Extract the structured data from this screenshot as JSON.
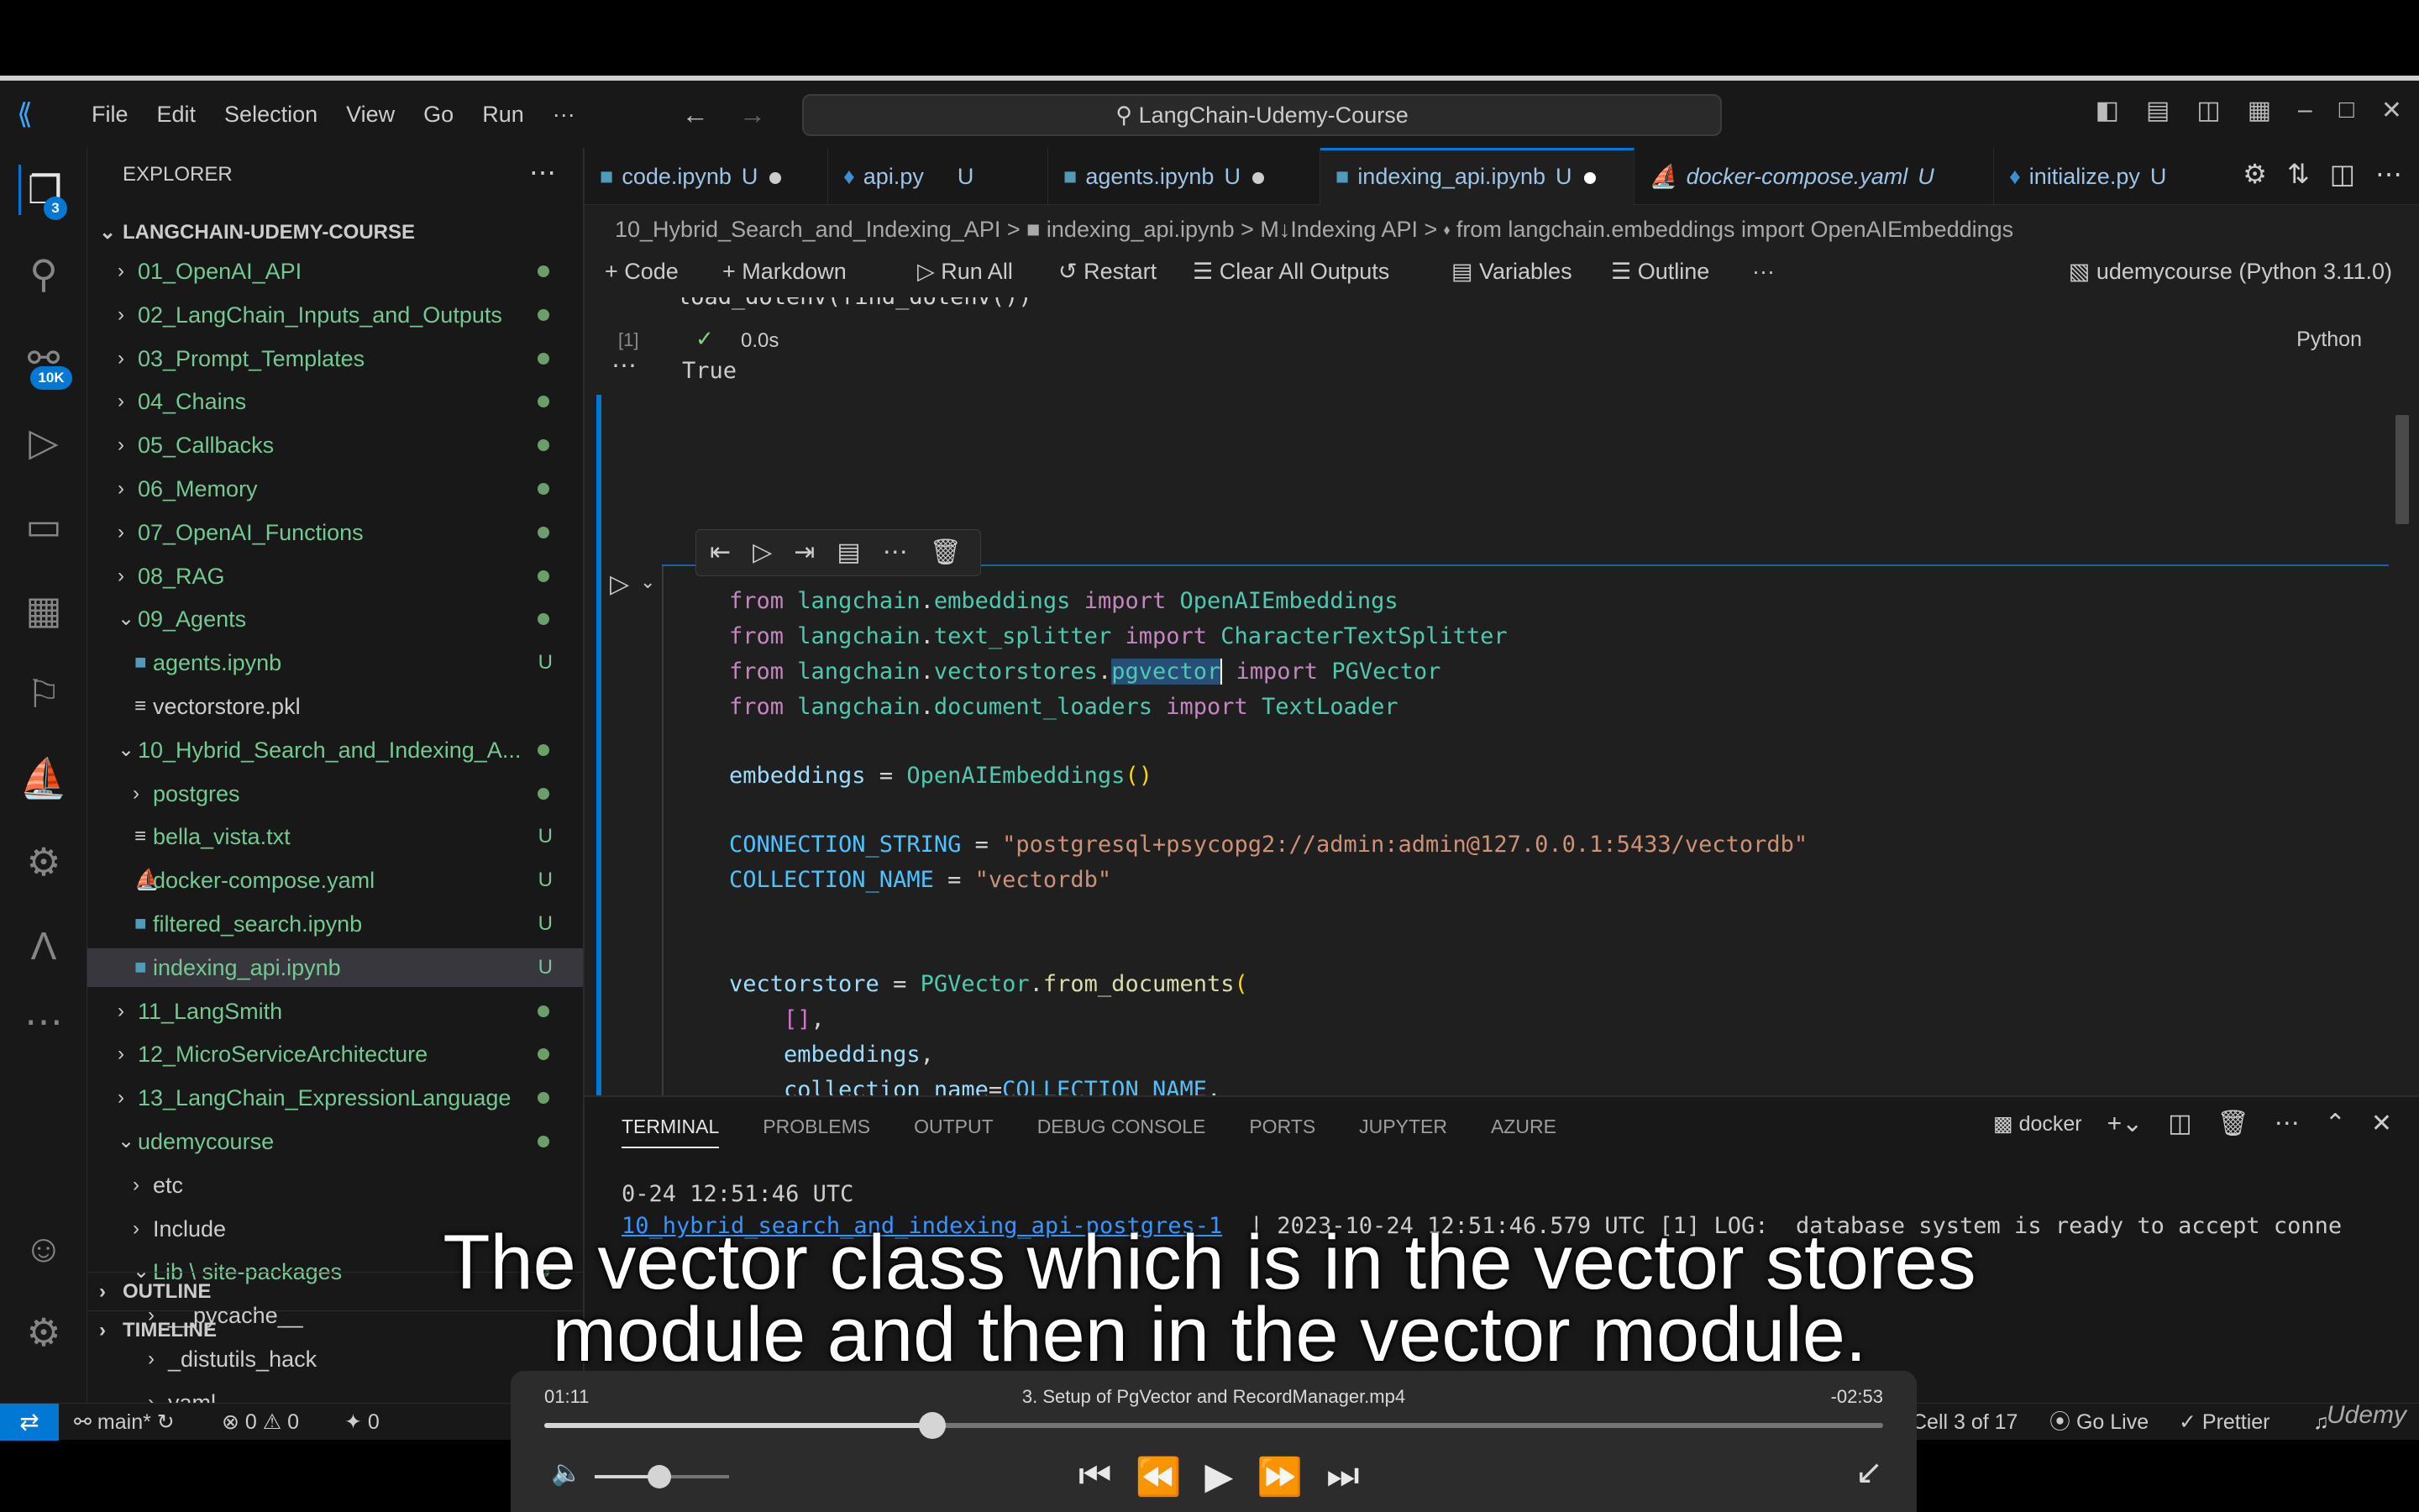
{
  "titlebar": {
    "menu": [
      "File",
      "Edit",
      "Selection",
      "View",
      "Go",
      "Run",
      "···"
    ],
    "search": "LangChain-Udemy-Course"
  },
  "activity": {
    "explorer_badge": "3",
    "source_control_badge": "10K"
  },
  "explorer": {
    "title": "EXPLORER",
    "root": "LANGCHAIN-UDEMY-COURSE",
    "items": [
      {
        "label": "01_OpenAI_API",
        "status": "dot",
        "chev": ">",
        "level": 1
      },
      {
        "label": "02_LangChain_Inputs_and_Outputs",
        "status": "dot",
        "chev": ">",
        "level": 1
      },
      {
        "label": "03_Prompt_Templates",
        "status": "dot",
        "chev": ">",
        "level": 1
      },
      {
        "label": "04_Chains",
        "status": "dot",
        "chev": ">",
        "level": 1
      },
      {
        "label": "05_Callbacks",
        "status": "dot",
        "chev": ">",
        "level": 1
      },
      {
        "label": "06_Memory",
        "status": "dot",
        "chev": ">",
        "level": 1
      },
      {
        "label": "07_OpenAI_Functions",
        "status": "dot",
        "chev": ">",
        "level": 1
      },
      {
        "label": "08_RAG",
        "status": "dot",
        "chev": ">",
        "level": 1
      },
      {
        "label": "09_Agents",
        "status": "dot",
        "chev": "v",
        "level": 1
      },
      {
        "label": "agents.ipynb",
        "status": "U",
        "chev": "",
        "level": 2
      },
      {
        "label": "vectorstore.pkl",
        "status": "",
        "chev": "",
        "level": 2
      },
      {
        "label": "10_Hybrid_Search_and_Indexing_A...",
        "status": "dot",
        "chev": "v",
        "level": 1
      },
      {
        "label": "postgres",
        "status": "dot",
        "chev": ">",
        "level": 2
      },
      {
        "label": "bella_vista.txt",
        "status": "U",
        "chev": "",
        "level": 2
      },
      {
        "label": "docker-compose.yaml",
        "status": "U",
        "chev": "",
        "level": 2
      },
      {
        "label": "filtered_search.ipynb",
        "status": "U",
        "chev": "",
        "level": 2
      },
      {
        "label": "indexing_api.ipynb",
        "status": "U",
        "chev": "",
        "level": 2
      },
      {
        "label": "11_LangSmith",
        "status": "dot",
        "chev": ">",
        "level": 1
      },
      {
        "label": "12_MicroServiceArchitecture",
        "status": "dot",
        "chev": ">",
        "level": 1
      },
      {
        "label": "13_LangChain_ExpressionLanguage",
        "status": "dot",
        "chev": ">",
        "level": 1
      },
      {
        "label": "udemycourse",
        "status": "dot",
        "chev": "v",
        "level": 1
      },
      {
        "label": "etc",
        "status": "",
        "chev": ">",
        "level": 2
      },
      {
        "label": "Include",
        "status": "",
        "chev": ">",
        "level": 2
      },
      {
        "label": "Lib \\ site-packages",
        "status": "dot",
        "chev": "v",
        "level": 2
      },
      {
        "label": "__pycache__",
        "status": "",
        "chev": ">",
        "level": 3
      },
      {
        "label": "_distutils_hack",
        "status": "",
        "chev": ">",
        "level": 3
      },
      {
        "label": "yaml",
        "status": "",
        "chev": ">",
        "level": 3
      }
    ],
    "outline": "OUTLINE",
    "timeline": "TIMELINE"
  },
  "tabs": [
    {
      "label": "code.ipynb",
      "status": "U",
      "modified": true
    },
    {
      "label": "api.py",
      "status": "U",
      "modified": false
    },
    {
      "label": "agents.ipynb",
      "status": "U",
      "modified": true
    },
    {
      "label": "indexing_api.ipynb",
      "status": "U",
      "modified": true,
      "active": true
    },
    {
      "label": "docker-compose.yaml",
      "status": "U",
      "modified": false
    },
    {
      "label": "initialize.py",
      "status": "U",
      "modified": false
    }
  ],
  "breadcrumb": "10_Hybrid_Search_and_Indexing_API > ■ indexing_api.ipynb > M↓Indexing API > ⬪ from langchain.embeddings import OpenAIEmbeddings",
  "nbtoolbar": {
    "code": "+ Code",
    "markdown": "+ Markdown",
    "run_all": "▷ Run All",
    "restart": "↺ Restart",
    "clear": "☰ Clear All Outputs",
    "variables": "▤ Variables",
    "outline": "☰ Outline",
    "more": "···",
    "kernel": "udemycourse (Python 3.11.0)"
  },
  "cell1": {
    "top_code": "load_dotenv(find_dotenv())",
    "exec_count": "[1]",
    "time": "0.0s",
    "lang": "Python",
    "output": "True"
  },
  "terminal": {
    "tabs": [
      "TERMINAL",
      "PROBLEMS",
      "OUTPUT",
      "DEBUG CONSOLE",
      "PORTS",
      "JUPYTER",
      "AZURE"
    ],
    "shell": "docker",
    "line1": "0-24 12:51:46 UTC",
    "line2_link": "10_hybrid_search_and_indexing_api-postgres-1",
    "line2_rest": "  | 2023-10-24 12:51:46.579 UTC [1] LOG:  database system is ready to accept conne"
  },
  "status": {
    "branch": "main*",
    "errors": "0",
    "warnings": "0",
    "ports": "0",
    "cell": "Cell 3 of 17",
    "golive": "Go Live",
    "prettier": "Prettier"
  },
  "captions": {
    "line1": "The vector class which is in the vector stores",
    "line2": "module and then in the vector module."
  },
  "player": {
    "elapsed": "01:11",
    "remaining": "-02:53",
    "title": "3. Setup of PgVector and RecordManager.mp4",
    "progress": 0.29,
    "volume": 0.48
  },
  "watermark": "Udemy"
}
